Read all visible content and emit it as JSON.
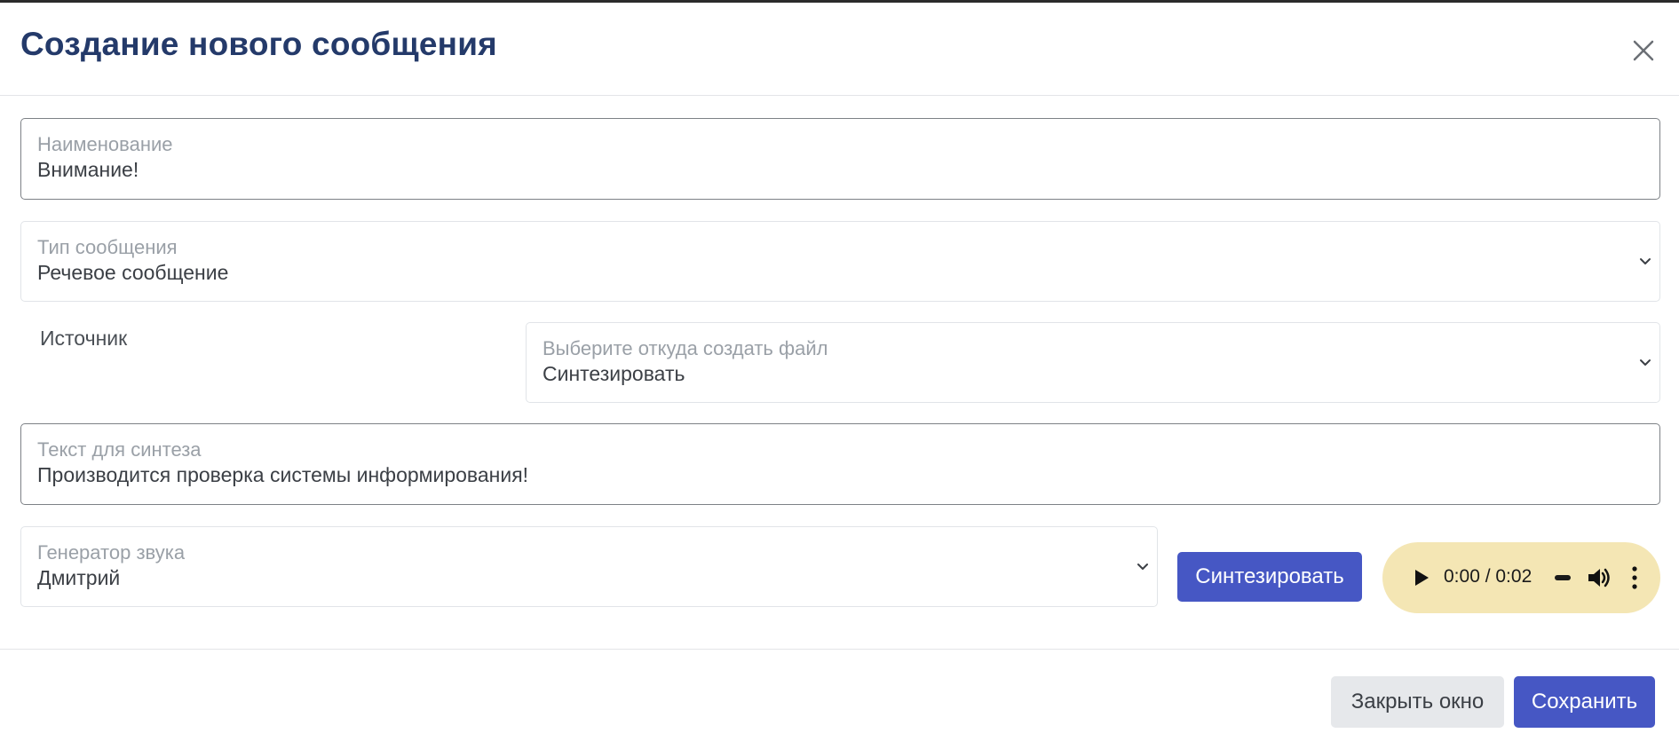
{
  "dialog": {
    "title": "Создание нового сообщения",
    "close_icon": "close-icon"
  },
  "form": {
    "name": {
      "label": "Наименование",
      "value": "Внимание!"
    },
    "message_type": {
      "label": "Тип сообщения",
      "value": "Речевое сообщение"
    },
    "source": {
      "label": "Источник",
      "select_label": "Выберите откуда создать файл",
      "value": "Синтезировать"
    },
    "synthesis_text": {
      "label": "Текст для синтеза",
      "value": "Производится проверка системы информирования!"
    },
    "voice_generator": {
      "label": "Генератор звука",
      "value": "Дмитрий"
    },
    "synthesize_button": "Синтезировать"
  },
  "audio_player": {
    "time": "0:00 / 0:02",
    "icons": [
      "play-icon",
      "progress-slider",
      "volume-icon",
      "more-options-icon"
    ],
    "background_color": "#f4e6b4"
  },
  "footer": {
    "close_button": "Закрыть окно",
    "save_button": "Сохранить"
  },
  "colors": {
    "title": "#243a6a",
    "primary": "#4657c4",
    "secondary": "#e6e8eb"
  }
}
